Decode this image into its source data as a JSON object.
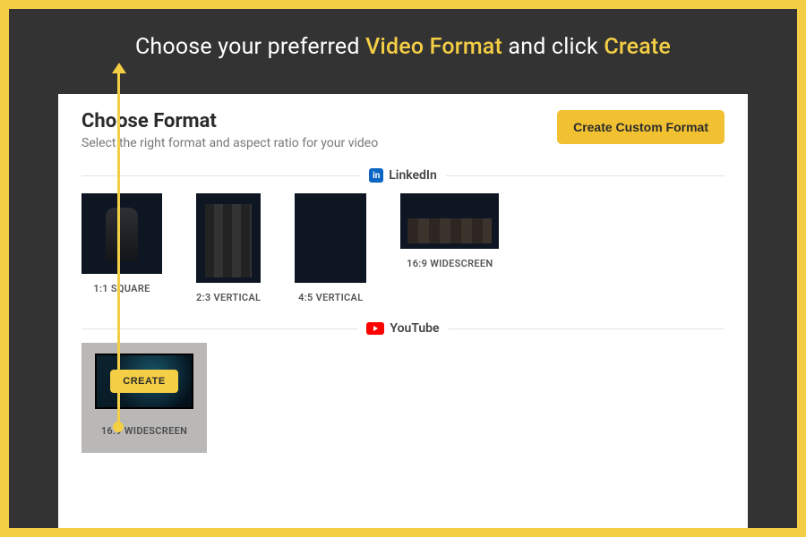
{
  "instruction": {
    "pre": "Choose  your preferred  ",
    "hl1": "Video Format",
    "mid": " and click ",
    "hl2": "Create"
  },
  "panel": {
    "title": "Choose Format",
    "subtitle": "Select the right format and aspect ratio for your video",
    "custom_button": "Create Custom Format"
  },
  "platforms": {
    "linkedin": {
      "label": "LinkedIn",
      "icon": "linkedin-icon"
    },
    "youtube": {
      "label": "YouTube",
      "icon": "youtube-icon"
    }
  },
  "linkedin_formats": [
    {
      "label": "1:1 SQUARE"
    },
    {
      "label": "2:3 VERTICAL"
    },
    {
      "label": "4:5 VERTICAL"
    },
    {
      "label": "16:9 WIDESCREEN"
    }
  ],
  "youtube_formats": [
    {
      "label": "16:9 WIDESCREEN",
      "create_label": "CREATE",
      "selected": true
    }
  ],
  "colors": {
    "accent": "#F4CE45",
    "panel_bg": "#ffffff",
    "frame_dark": "#333333"
  }
}
